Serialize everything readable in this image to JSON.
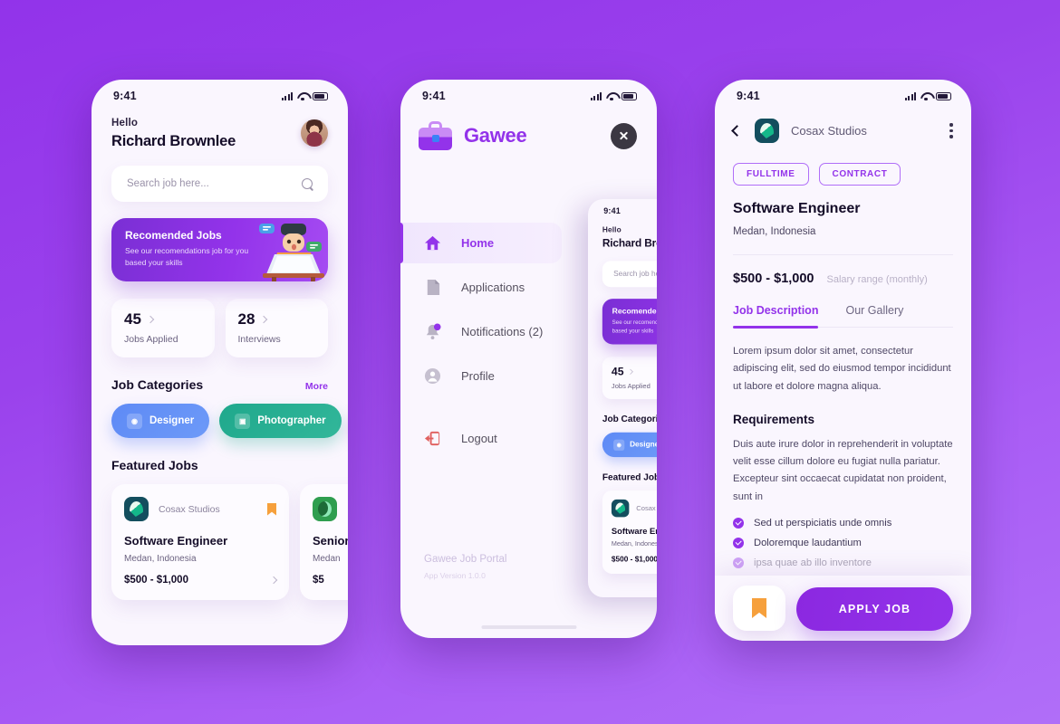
{
  "theme": {
    "accent": "#9333ea",
    "bg_gradient_from": "#9233ea",
    "bg_gradient_to": "#b06ef8",
    "bookmark_orange": "#f6a03c"
  },
  "status_bar": {
    "time": "9:41",
    "signal_icon": "signal-bars-icon",
    "wifi_icon": "wifi-icon",
    "battery_icon": "battery-icon"
  },
  "phone1": {
    "greeting": "Hello",
    "user_name": "Richard Brownlee",
    "avatar_icon": "user-avatar",
    "search": {
      "placeholder": "Search job here...",
      "icon": "search-icon"
    },
    "promo": {
      "title": "Recomended Jobs",
      "subtitle": "See our recomendations job for you based your skills",
      "illustration": "person-at-laptop-illustration"
    },
    "stats": [
      {
        "value": "45",
        "label": "Jobs Applied"
      },
      {
        "value": "28",
        "label": "Interviews"
      }
    ],
    "categories_section": {
      "title": "Job Categories",
      "more_label": "More"
    },
    "categories": [
      {
        "label": "Designer",
        "icon": "palette-icon",
        "color": "#5e8af5"
      },
      {
        "label": "Photographer",
        "icon": "camera-icon",
        "color": "#1fa88c"
      },
      {
        "label": "",
        "icon": "code-icon",
        "color": "#c026d3"
      }
    ],
    "featured_section": {
      "title": "Featured Jobs"
    },
    "featured_jobs": [
      {
        "company": "Cosax Studios",
        "logo_icon": "cosax-logo",
        "title": "Software Engineer",
        "location": "Medan, Indonesia",
        "salary": "$500 - $1,000",
        "bookmark_icon": "bookmark-icon"
      },
      {
        "company": "",
        "logo_icon": "green-company-logo",
        "title": "Senior",
        "location": "Medan",
        "salary": "$5",
        "bookmark_icon": "bookmark-icon"
      }
    ]
  },
  "phone2": {
    "brand": {
      "name": "Gawee",
      "logo_icon": "briefcase-logo"
    },
    "close_icon": "close-icon",
    "menu": [
      {
        "label": "Home",
        "icon": "home-icon",
        "active": true
      },
      {
        "label": "Applications",
        "icon": "document-icon",
        "active": false
      },
      {
        "label": "Notifications (2)",
        "icon": "bell-icon",
        "active": false,
        "badge": "2"
      },
      {
        "label": "Profile",
        "icon": "person-icon",
        "active": false
      },
      {
        "label": "Logout",
        "icon": "logout-icon",
        "active": false
      }
    ],
    "footer": {
      "title": "Gawee Job Portal",
      "version": "App Version 1.0.0"
    },
    "home_indicator": "home-indicator"
  },
  "phone3": {
    "back_icon": "back-arrow-icon",
    "company": "Cosax Studios",
    "company_logo_icon": "cosax-logo",
    "overflow_icon": "more-vertical-icon",
    "tags": [
      "FULLTIME",
      "CONTRACT"
    ],
    "title": "Software Engineer",
    "location": "Medan, Indonesia",
    "salary": "$500 - $1,000",
    "salary_label": "Salary range (monthly)",
    "tabs": [
      {
        "label": "Job Description",
        "active": true
      },
      {
        "label": "Our Gallery",
        "active": false
      }
    ],
    "description": "Lorem ipsum dolor sit amet, consectetur adipiscing elit, sed do eiusmod tempor incididunt ut labore et dolore magna aliqua.",
    "requirements_heading": "Requirements",
    "requirements_intro": "Duis aute irure dolor in reprehenderit in voluptate velit esse cillum dolore eu fugiat nulla pariatur. Excepteur sint occaecat cupidatat non proident, sunt in",
    "requirement_items": [
      {
        "text": "Sed ut perspiciatis unde omnis",
        "faded": false
      },
      {
        "text": "Doloremque laudantium",
        "faded": false
      },
      {
        "text": "ipsa quae ab illo inventore",
        "faded": true
      }
    ],
    "bookmark_icon": "bookmark-icon",
    "apply_label": "APPLY JOB"
  }
}
